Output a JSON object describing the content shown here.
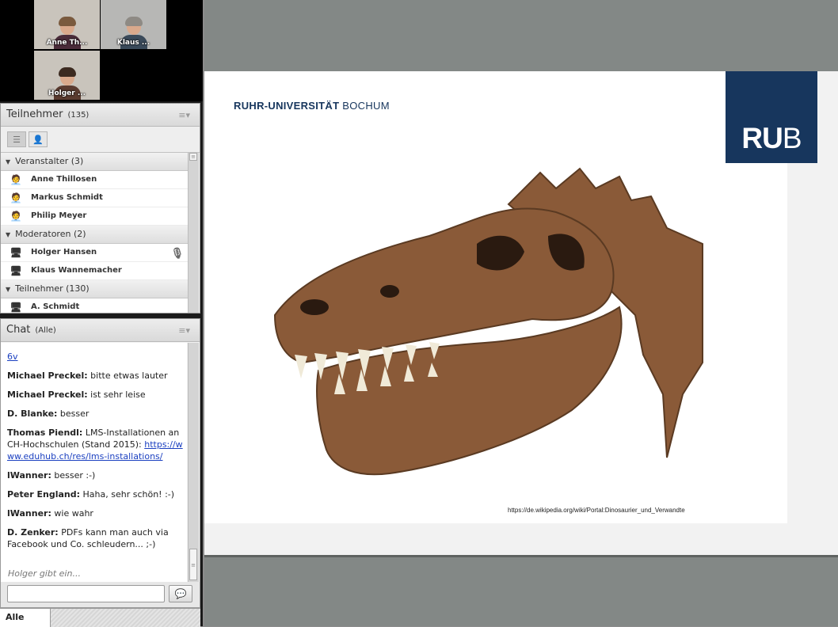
{
  "video": {
    "tiles": [
      {
        "name": "Anne Th..."
      },
      {
        "name": "Klaus ..."
      },
      {
        "name": "Holger ..."
      }
    ]
  },
  "attendees": {
    "title": "Teilnehmer",
    "count": "(135)",
    "groups": [
      {
        "label": "Veranstalter (3)",
        "members": [
          "Anne Thillosen",
          "Markus Schmidt",
          "Philip Meyer"
        ]
      },
      {
        "label": "Moderatoren (2)",
        "members": [
          "Holger Hansen",
          "Klaus Wannemacher"
        ]
      },
      {
        "label": "Teilnehmer (130)",
        "members": [
          "A. Schmidt"
        ]
      }
    ],
    "icons": {
      "host": "host-icon",
      "presenter": "presenter-icon",
      "speaking": "microphone-speaking-icon"
    }
  },
  "chat": {
    "title": "Chat",
    "scope": "(Alle)",
    "messages": [
      {
        "link": "6v"
      },
      {
        "name": "Michael Preckel:",
        "text": " bitte etwas lauter"
      },
      {
        "name": "Michael Preckel:",
        "text": " ist sehr leise"
      },
      {
        "name": "D. Blanke:",
        "text": " besser"
      },
      {
        "name": "Thomas Piendl:",
        "text": " LMS-Installationen an CH-Hochschulen (Stand 2015): ",
        "link": "https://www.eduhub.ch/res/lms-installations/"
      },
      {
        "name": "lWanner:",
        "text": " besser :-)"
      },
      {
        "name": "Peter England:",
        "text": " Haha, sehr schön! :-)"
      },
      {
        "name": "lWanner:",
        "text": " wie wahr"
      },
      {
        "name": "D. Zenker:",
        "text": " PDFs kann man auch via Facebook und Co. schleudern... ;-)"
      }
    ],
    "typing": "Holger gibt ein...",
    "input_value": "",
    "tab": "Alle"
  },
  "slide": {
    "university_bold": "RUHR-UNIVERSITÄT",
    "university_rest": " BOCHUM",
    "logo_bold": "RU",
    "logo_rest": "B",
    "credit": "https://de.wikipedia.org/wiki/Portal:Dinosaurier_und_Verwandte",
    "colors": {
      "brand": "#17365d",
      "bone": "#8a5a38"
    }
  }
}
